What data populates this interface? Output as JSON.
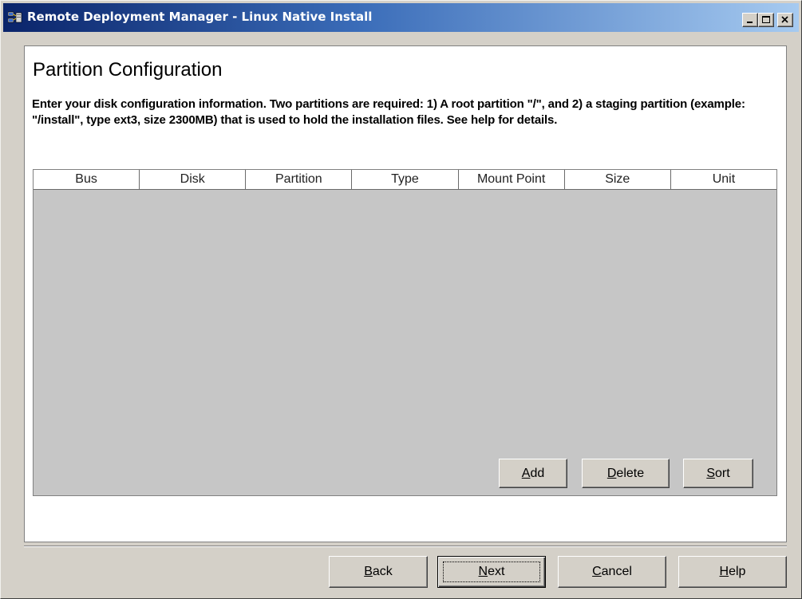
{
  "window": {
    "title": "Remote Deployment Manager - Linux Native Install",
    "controls": {
      "minimize": "minimize-icon",
      "maximize": "maximize-icon",
      "close": "close-icon"
    }
  },
  "page": {
    "title": "Partition Configuration",
    "instructions": "Enter your disk configuration information.  Two partitions are required:  1) A root partition \"/\", and 2) a staging partition (example: \"/install\", type ext3, size 2300MB) that is used to hold the installation files.  See help for details."
  },
  "partition_table": {
    "columns": [
      "Bus",
      "Disk",
      "Partition",
      "Type",
      "Mount Point",
      "Size",
      "Unit"
    ],
    "rows": []
  },
  "table_actions": {
    "add": {
      "hotkey": "A",
      "rest": "dd"
    },
    "delete": {
      "hotkey": "D",
      "rest": "elete"
    },
    "sort": {
      "hotkey": "S",
      "rest": "ort"
    }
  },
  "wizard_buttons": {
    "back": {
      "hotkey": "B",
      "rest": "ack"
    },
    "next": {
      "hotkey": "N",
      "rest": "ext"
    },
    "cancel": {
      "hotkey": "C",
      "rest": "ancel"
    },
    "help": {
      "hotkey": "H",
      "rest": "elp"
    }
  },
  "colors": {
    "title_gradient_start": "#0a246a",
    "title_gradient_end": "#a6caf0",
    "face": "#d4d0c8",
    "table_body": "#c6c6c6"
  }
}
